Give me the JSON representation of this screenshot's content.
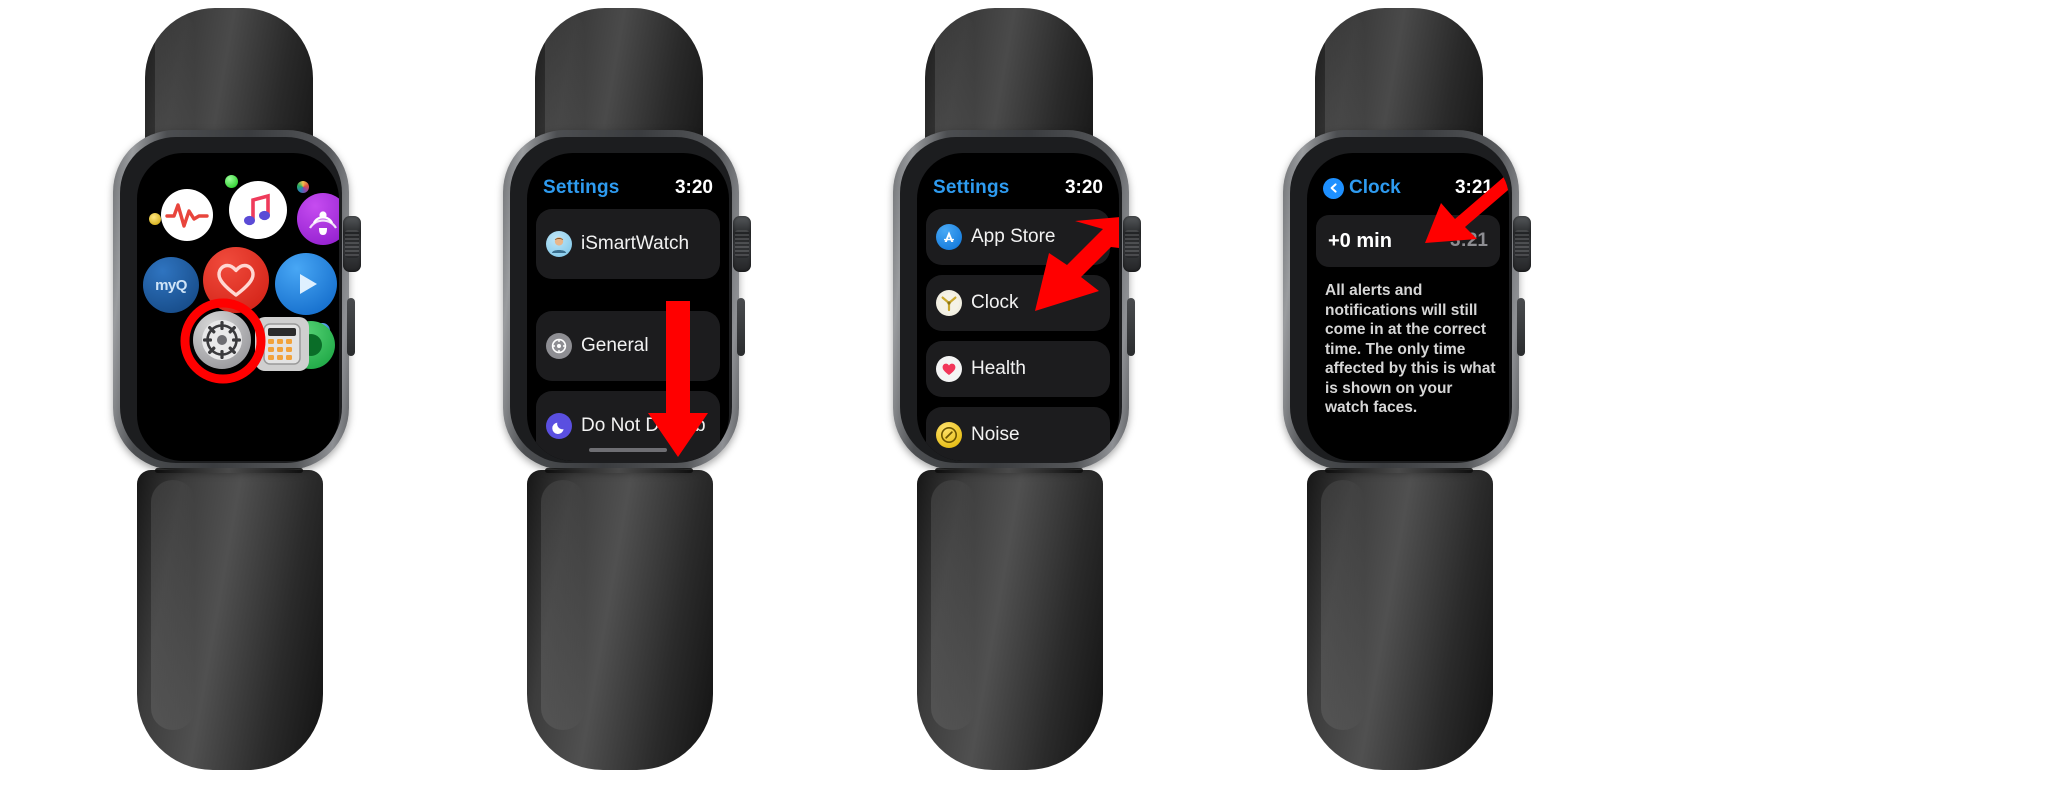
{
  "meta": {
    "description": "Apple Watch tutorial: four screenshots showing navigation from the app grid to Settings, to Clock, to the time offset screen",
    "accent_blue": "#2e9bf0",
    "arrow_red": "#ff0000",
    "row_bg": "#1c1c1e",
    "screen_bg": "#000000"
  },
  "watches": [
    {
      "id": "watch-1",
      "screen_type": "app-grid",
      "apps": [
        {
          "name": "heart-rate-app",
          "label": "Heart Rate",
          "color": "#ffffff"
        },
        {
          "name": "music-app",
          "label": "Music",
          "color": "#ffffff"
        },
        {
          "name": "podcasts-app",
          "label": "Podcasts",
          "color": "#9b2fd6"
        },
        {
          "name": "myq-app",
          "label": "myQ",
          "color": "#1b5fa8"
        },
        {
          "name": "heart-app",
          "label": "Heart",
          "color": "#e03131"
        },
        {
          "name": "play-app",
          "label": "Play",
          "color": "#1e8ae8"
        },
        {
          "name": "green-app",
          "label": "Green App",
          "color": "#2fb84f"
        },
        {
          "name": "settings-app",
          "label": "Settings",
          "color": "#8e8e93"
        },
        {
          "name": "calculator-app",
          "label": "Calculator",
          "color": "#d8d8d8"
        }
      ],
      "highlight": {
        "name": "settings-highlight-circle",
        "target": "Settings",
        "color": "#ff0000"
      }
    },
    {
      "id": "watch-2",
      "screen_type": "settings-list",
      "status": {
        "title": "Settings",
        "time": "3:20"
      },
      "rows": [
        {
          "name": "row-ismartwatch",
          "label": "iSmartWatch",
          "icon": "avatar-icon"
        },
        {
          "name": "row-general",
          "label": "General",
          "icon": "gear-icon"
        },
        {
          "name": "row-do-not-disturb",
          "label": "Do Not Disturb",
          "icon": "moon-icon"
        }
      ],
      "annotation": {
        "name": "scroll-down-arrow",
        "type": "arrow-down",
        "color": "#ff0000"
      }
    },
    {
      "id": "watch-3",
      "screen_type": "settings-list",
      "status": {
        "title": "Settings",
        "time": "3:20"
      },
      "rows": [
        {
          "name": "row-app-store",
          "label": "App Store",
          "icon": "app-store-icon"
        },
        {
          "name": "row-clock",
          "label": "Clock",
          "icon": "clock-icon"
        },
        {
          "name": "row-health",
          "label": "Health",
          "icon": "health-heart-icon"
        },
        {
          "name": "row-noise",
          "label": "Noise",
          "icon": "noise-icon"
        }
      ],
      "annotation": {
        "name": "clock-pointer-arrow",
        "type": "arrow-left-down",
        "color": "#ff0000",
        "target": "Clock"
      }
    },
    {
      "id": "watch-4",
      "screen_type": "clock-detail",
      "status": {
        "back_label": "Clock",
        "time": "3:21"
      },
      "value_row": {
        "name": "time-offset-row",
        "left": "+0 min",
        "right": "3:21"
      },
      "body": "All alerts and notifications will still come in at the correct time. The only time affected by this is what is shown on your watch faces.",
      "annotation": {
        "name": "offset-pointer-arrow",
        "type": "arrow-down-left",
        "color": "#ff0000",
        "target": "+0 min"
      }
    }
  ]
}
